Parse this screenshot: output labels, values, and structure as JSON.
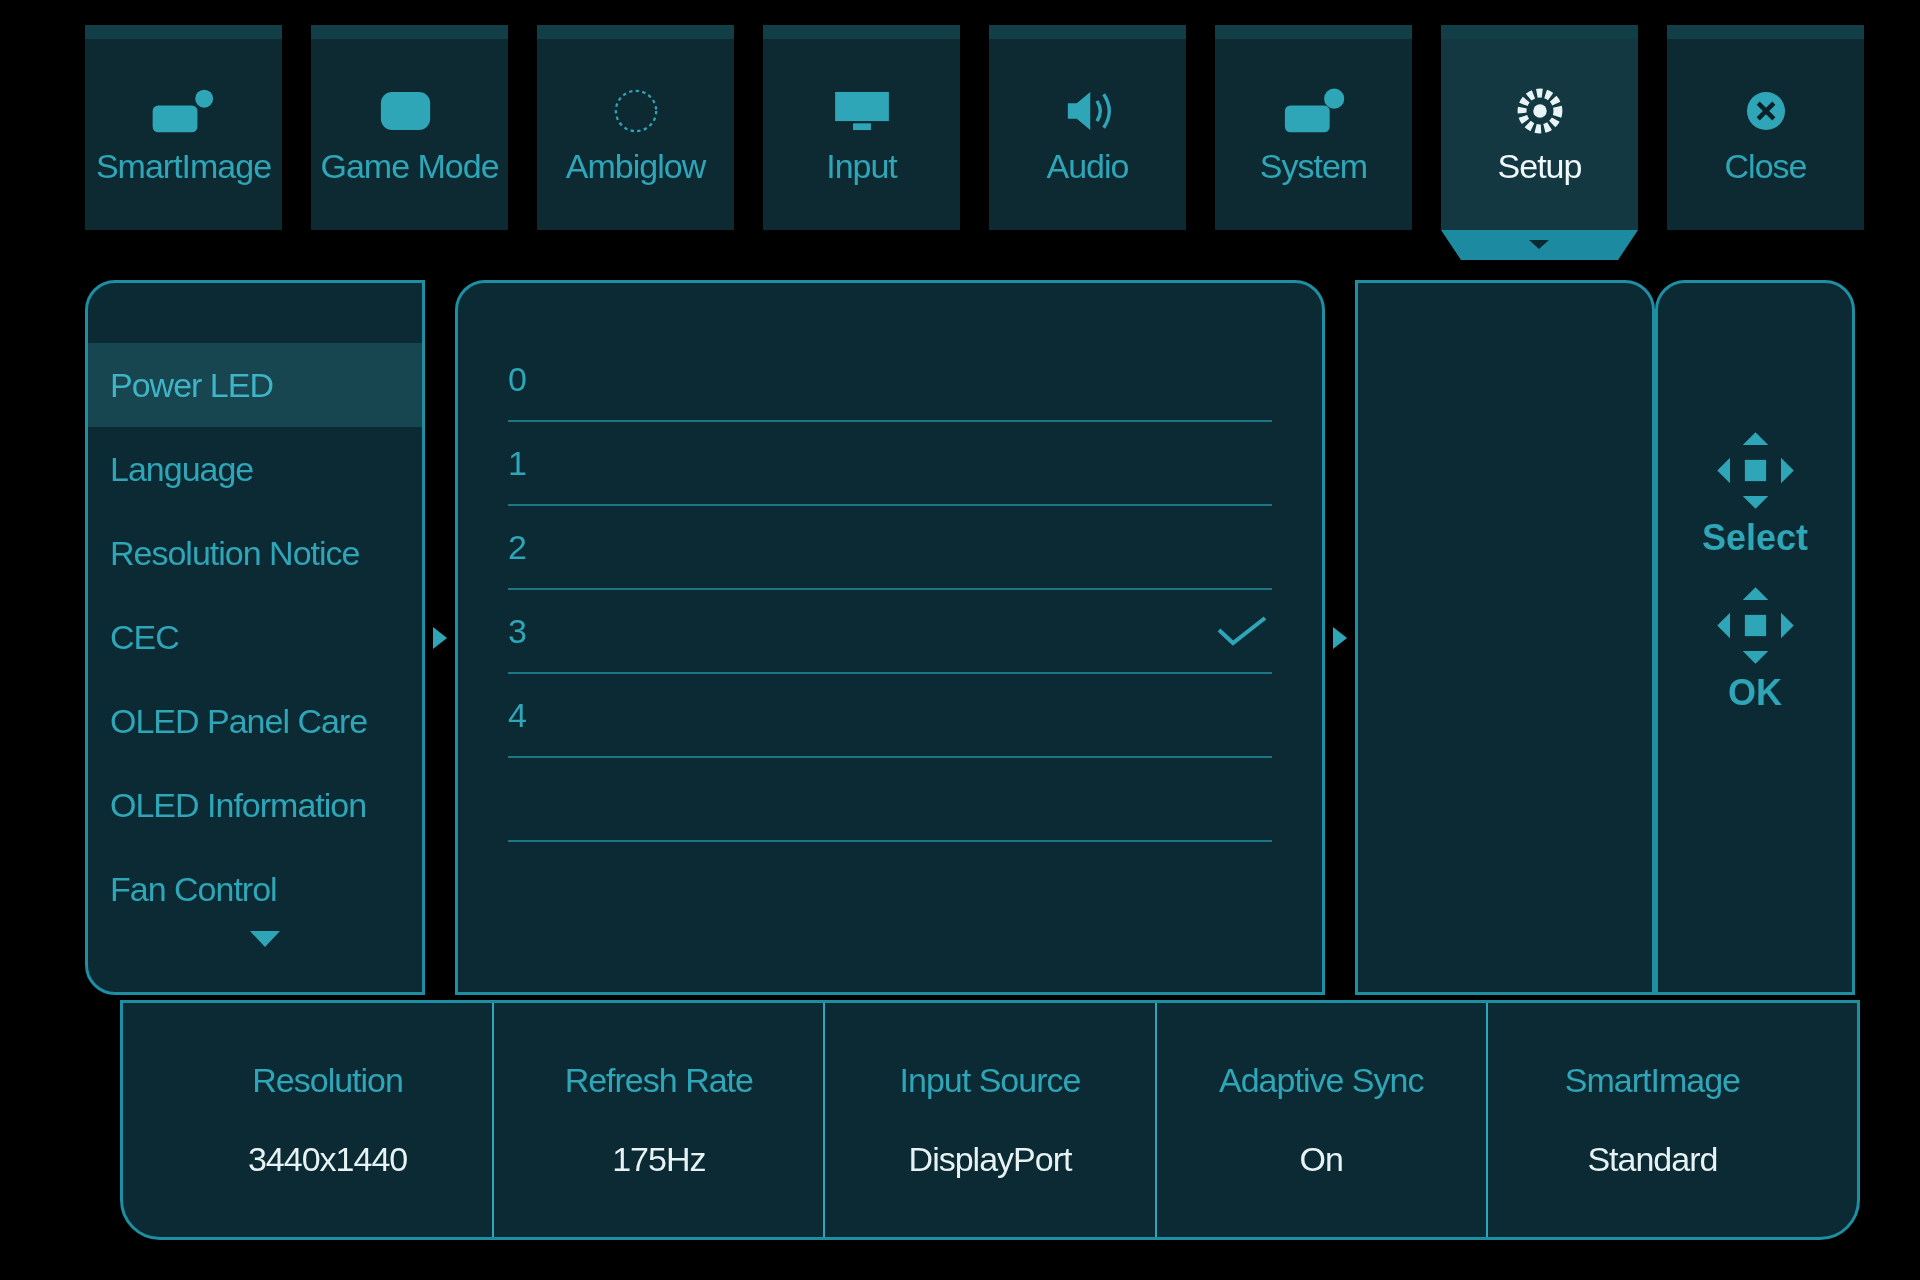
{
  "tabs": [
    {
      "label": "SmartImage",
      "selected": false
    },
    {
      "label": "Game Mode",
      "selected": false
    },
    {
      "label": "Ambiglow",
      "selected": false
    },
    {
      "label": "Input",
      "selected": false
    },
    {
      "label": "Audio",
      "selected": false
    },
    {
      "label": "System",
      "selected": false
    },
    {
      "label": "Setup",
      "selected": true
    },
    {
      "label": "Close",
      "selected": false
    }
  ],
  "menu": {
    "items": [
      {
        "label": "Power LED",
        "selected": true
      },
      {
        "label": "Language",
        "selected": false
      },
      {
        "label": "Resolution Notice",
        "selected": false
      },
      {
        "label": "CEC",
        "selected": false
      },
      {
        "label": "OLED Panel Care",
        "selected": false
      },
      {
        "label": "OLED Information",
        "selected": false
      },
      {
        "label": "Fan Control",
        "selected": false
      }
    ]
  },
  "options": [
    {
      "label": "0",
      "checked": false
    },
    {
      "label": "1",
      "checked": false
    },
    {
      "label": "2",
      "checked": false
    },
    {
      "label": "3",
      "checked": true
    },
    {
      "label": "4",
      "checked": false
    }
  ],
  "controls": [
    "Select",
    "OK"
  ],
  "status": [
    {
      "label": "Resolution",
      "value": "3440x1440"
    },
    {
      "label": "Refresh Rate",
      "value": "175Hz"
    },
    {
      "label": "Input Source",
      "value": "DisplayPort"
    },
    {
      "label": "Adaptive Sync",
      "value": "On"
    },
    {
      "label": "SmartImage",
      "value": "Standard"
    }
  ]
}
